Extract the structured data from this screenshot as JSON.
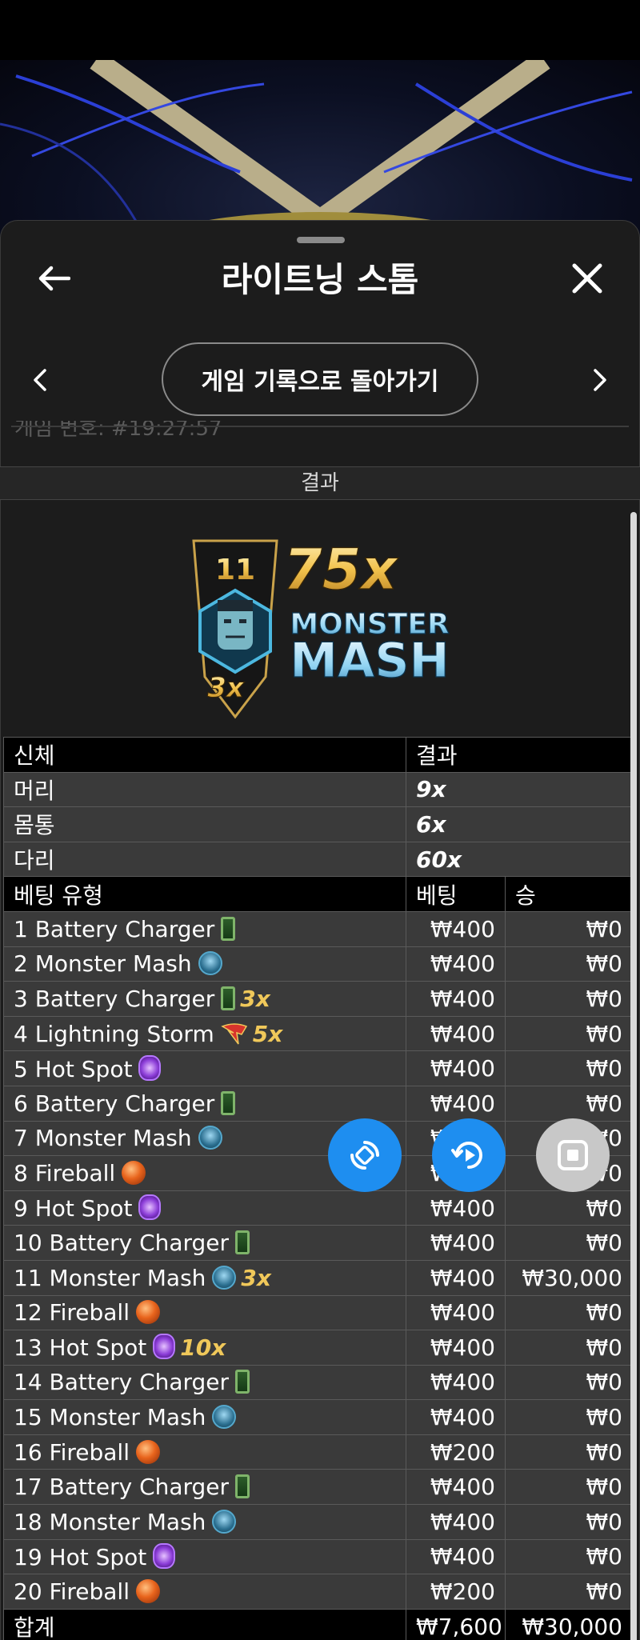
{
  "header": {
    "title": "라이트닝 스톰"
  },
  "nav": {
    "history_label": "게임 기록으로 돌아가기"
  },
  "game": {
    "id_label": "게임 번호: #19:27:57"
  },
  "result": {
    "header": "결과",
    "number": "11",
    "multiplier": "75x",
    "badge_multiplier": "3x",
    "name_line1": "MONSTER",
    "name_line2": "MASH"
  },
  "body_table": {
    "col_part": "신체",
    "col_result": "결과",
    "rows": [
      {
        "part": "머리",
        "value": "9x"
      },
      {
        "part": "몸통",
        "value": "6x"
      },
      {
        "part": "다리",
        "value": "60x"
      }
    ]
  },
  "bets_table": {
    "col_type": "베팅 유형",
    "col_bet": "베팅",
    "col_win": "승",
    "rows": [
      {
        "label": "1 Battery Charger",
        "icon": "battery-icon",
        "tag": "",
        "bet": "₩400",
        "win": "₩0"
      },
      {
        "label": "2 Monster Mash",
        "icon": "monster-icon",
        "tag": "",
        "bet": "₩400",
        "win": "₩0"
      },
      {
        "label": "3 Battery Charger",
        "icon": "battery-icon",
        "tag": "3x",
        "bet": "₩400",
        "win": "₩0"
      },
      {
        "label": "4 Lightning Storm",
        "icon": "lightning-icon",
        "tag": "5x",
        "bet": "₩400",
        "win": "₩0"
      },
      {
        "label": "5 Hot Spot",
        "icon": "hotspot-icon",
        "tag": "",
        "bet": "₩400",
        "win": "₩0"
      },
      {
        "label": "6 Battery Charger",
        "icon": "battery-icon",
        "tag": "",
        "bet": "₩400",
        "win": "₩0"
      },
      {
        "label": "7 Monster Mash",
        "icon": "monster-icon",
        "tag": "",
        "bet": "₩400",
        "win": "₩0"
      },
      {
        "label": "8 Fireball",
        "icon": "fireball-icon",
        "tag": "",
        "bet": "₩400",
        "win": "₩0"
      },
      {
        "label": "9 Hot Spot",
        "icon": "hotspot-icon",
        "tag": "",
        "bet": "₩400",
        "win": "₩0"
      },
      {
        "label": "10 Battery Charger",
        "icon": "battery-icon",
        "tag": "",
        "bet": "₩400",
        "win": "₩0"
      },
      {
        "label": "11 Monster Mash",
        "icon": "monster-icon",
        "tag": "3x",
        "bet": "₩400",
        "win": "₩30,000"
      },
      {
        "label": "12 Fireball",
        "icon": "fireball-icon",
        "tag": "",
        "bet": "₩400",
        "win": "₩0"
      },
      {
        "label": "13 Hot Spot",
        "icon": "hotspot-icon",
        "tag": "10x",
        "bet": "₩400",
        "win": "₩0"
      },
      {
        "label": "14 Battery Charger",
        "icon": "battery-icon",
        "tag": "",
        "bet": "₩400",
        "win": "₩0"
      },
      {
        "label": "15 Monster Mash",
        "icon": "monster-icon",
        "tag": "",
        "bet": "₩400",
        "win": "₩0"
      },
      {
        "label": "16 Fireball",
        "icon": "fireball-icon",
        "tag": "",
        "bet": "₩200",
        "win": "₩0"
      },
      {
        "label": "17 Battery Charger",
        "icon": "battery-icon",
        "tag": "",
        "bet": "₩400",
        "win": "₩0"
      },
      {
        "label": "18 Monster Mash",
        "icon": "monster-icon",
        "tag": "",
        "bet": "₩400",
        "win": "₩0"
      },
      {
        "label": "19 Hot Spot",
        "icon": "hotspot-icon",
        "tag": "",
        "bet": "₩400",
        "win": "₩0"
      },
      {
        "label": "20 Fireball",
        "icon": "fireball-icon",
        "tag": "",
        "bet": "₩200",
        "win": "₩0"
      }
    ],
    "total": {
      "label": "합계",
      "bet": "₩7,600",
      "win": "₩30,000"
    }
  },
  "colors": {
    "accent_blue": "#1e8ef0",
    "multiplier_gold": "#f0c85a",
    "sheet_bg": "#1c1c1c"
  }
}
